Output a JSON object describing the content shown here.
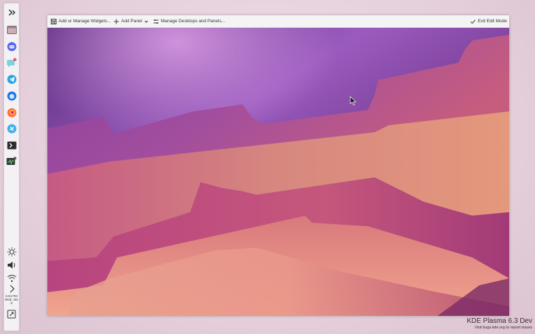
{
  "toolbar": {
    "widgets_label": "Add or Manage Widgets...",
    "add_panel_label": "Add Panel",
    "manage_desktops_label": "Manage Desktops and Panels...",
    "exit_edit_label": "Exit Edit Mode"
  },
  "panel": {
    "launchers": [
      {
        "icon": "kickoff-launcher-icon"
      },
      {
        "icon": "file-manager-icon"
      },
      {
        "icon": "discord-icon"
      },
      {
        "icon": "chat-icon",
        "badge": "1"
      },
      {
        "icon": "telegram-icon"
      },
      {
        "icon": "thunderbird-icon"
      },
      {
        "icon": "firefox-icon"
      },
      {
        "icon": "discover-icon"
      },
      {
        "icon": "terminal-icon"
      },
      {
        "icon": "system-monitor-icon"
      }
    ],
    "tray": [
      "brightness-icon",
      "volume-icon",
      "wifi-icon",
      "expand-arrow-icon"
    ],
    "clock_time": "5:04 PM",
    "clock_date": "Wed, Jan",
    "clock_day": "8"
  },
  "watermark": {
    "title": "KDE Plasma 6.3 Dev",
    "subtitle": "Visit bugs.kde.org to report issues"
  },
  "colors": {
    "panel_bg": "#f4f1f4",
    "toolbar_bg": "#f5f4f5",
    "wallpaper_dark": "#5a2c79",
    "wallpaper_light": "#e59b85"
  }
}
